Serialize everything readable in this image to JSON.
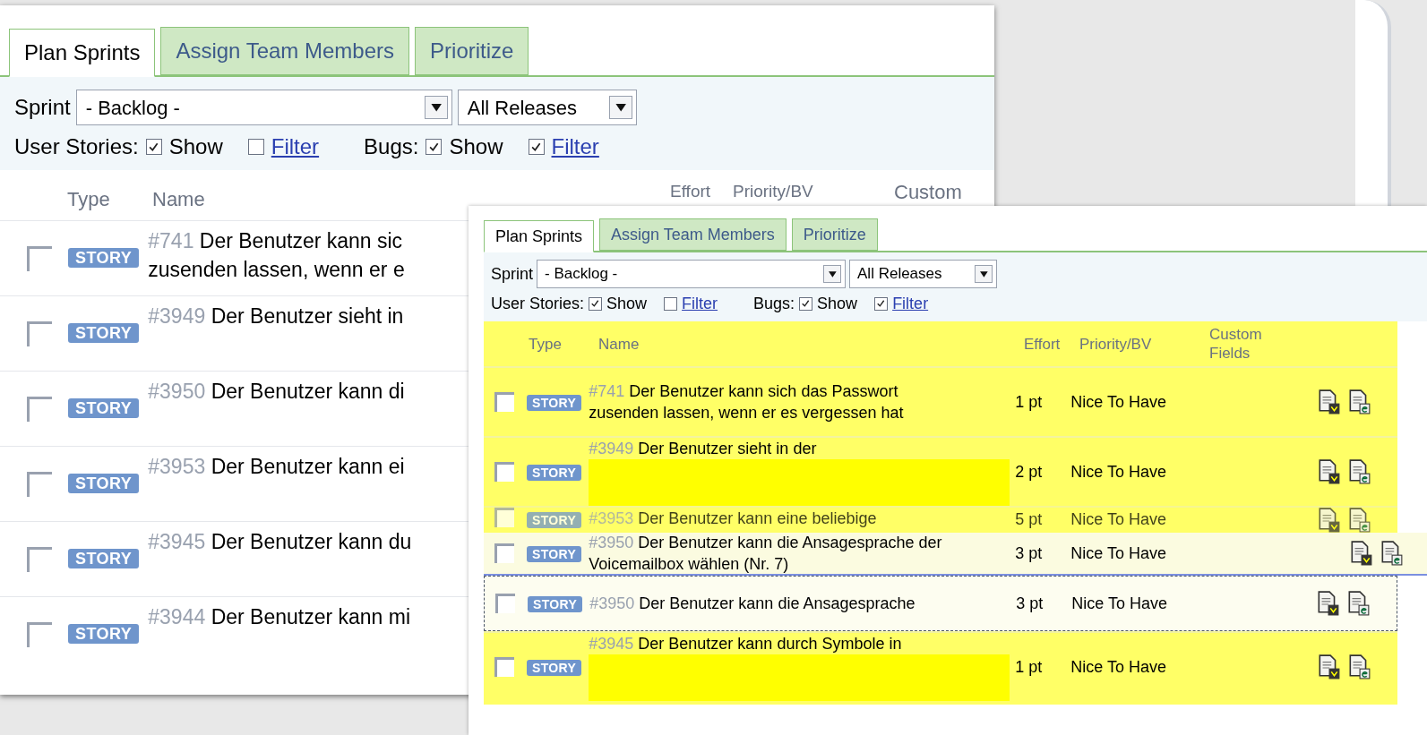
{
  "back_window": {
    "tabs": [
      {
        "label": "Plan Sprints",
        "selected": true
      },
      {
        "label": "Assign Team Members",
        "selected": false
      },
      {
        "label": "Prioritize",
        "selected": false
      }
    ],
    "sprint_label": "Sprint",
    "sprint_select": "- Backlog -",
    "release_select": "All Releases",
    "filters": [
      {
        "label": "User Stories:",
        "show": {
          "label": "Show",
          "checked": true
        },
        "filter": {
          "label": "Filter",
          "checked": false
        }
      },
      {
        "label": "Bugs:",
        "show": {
          "label": "Show",
          "checked": true
        },
        "filter": {
          "label": "Filter",
          "checked": true
        }
      }
    ],
    "columns": [
      "Type",
      "Name",
      "Effort",
      "Priority/BV",
      "Custom"
    ],
    "rows": [
      {
        "checked": false,
        "type": "STORY",
        "id": "#741",
        "lines": [
          "Der Benutzer kann sic",
          "zusenden lassen, wenn er e"
        ]
      },
      {
        "checked": false,
        "type": "STORY",
        "id": "#3949",
        "lines": [
          "Der Benutzer sieht in"
        ]
      },
      {
        "checked": false,
        "type": "STORY",
        "id": "#3950",
        "lines": [
          "Der Benutzer kann di"
        ]
      },
      {
        "checked": false,
        "type": "STORY",
        "id": "#3953",
        "lines": [
          "Der Benutzer kann ei"
        ]
      },
      {
        "checked": false,
        "type": "STORY",
        "id": "#3945",
        "lines": [
          "Der Benutzer kann du"
        ]
      },
      {
        "checked": false,
        "type": "STORY",
        "id": "#3944",
        "lines": [
          "Der Benutzer kann mi"
        ]
      }
    ]
  },
  "front_window": {
    "tabs": [
      {
        "label": "Plan Sprints",
        "selected": true
      },
      {
        "label": "Assign Team Members",
        "selected": false
      },
      {
        "label": "Prioritize",
        "selected": false
      }
    ],
    "sprint_label": "Sprint",
    "sprint_select": "- Backlog -",
    "release_select": "All Releases",
    "filters": [
      {
        "label": "User Stories:",
        "show": {
          "label": "Show",
          "checked": true
        },
        "filter": {
          "label": "Filter",
          "checked": false
        }
      },
      {
        "label": "Bugs:",
        "show": {
          "label": "Show",
          "checked": true
        },
        "filter": {
          "label": "Filter",
          "checked": true
        }
      }
    ],
    "columns": [
      "Type",
      "Name",
      "Effort",
      "Priority/BV",
      "Custom Fields"
    ],
    "rows": [
      {
        "kind": "normal",
        "checked": false,
        "type": "STORY",
        "id": "#741",
        "lines": [
          "Der Benutzer kann sich das Passwort",
          "zusenden lassen, wenn er es vergessen hat"
        ],
        "effort": "1 pt",
        "priority": "Nice To Have",
        "redacted": false
      },
      {
        "kind": "normal",
        "checked": false,
        "type": "STORY",
        "id": "#3949",
        "lines": [
          "Der Benutzer sieht in der"
        ],
        "effort": "2 pt",
        "priority": "Nice To Have",
        "redacted": true
      },
      {
        "kind": "dragged",
        "checked": false,
        "type": "STORY",
        "id": "#3953",
        "lines": [
          "Der Benutzer kann eine beliebige"
        ],
        "effort": "5 pt",
        "priority": "Nice To Have",
        "redacted": false
      },
      {
        "kind": "ghost",
        "checked": false,
        "type": "STORY",
        "id": "#3950",
        "lines": [
          "Der Benutzer kann die Ansagesprache der",
          "Voicemailbox wählen (Nr. 7)"
        ],
        "effort": "3 pt",
        "priority": "Nice To Have",
        "redacted": false
      },
      {
        "kind": "drop",
        "checked": false,
        "type": "STORY",
        "id": "#3950",
        "lines": [
          "Der Benutzer kann die Ansagesprache"
        ],
        "effort": "3 pt",
        "priority": "Nice To Have",
        "redacted": false
      },
      {
        "kind": "normal",
        "checked": false,
        "type": "STORY",
        "id": "#3945",
        "lines": [
          "Der Benutzer kann durch Symbole in"
        ],
        "effort": "1 pt",
        "priority": "Nice To Have",
        "redacted": true
      }
    ]
  }
}
